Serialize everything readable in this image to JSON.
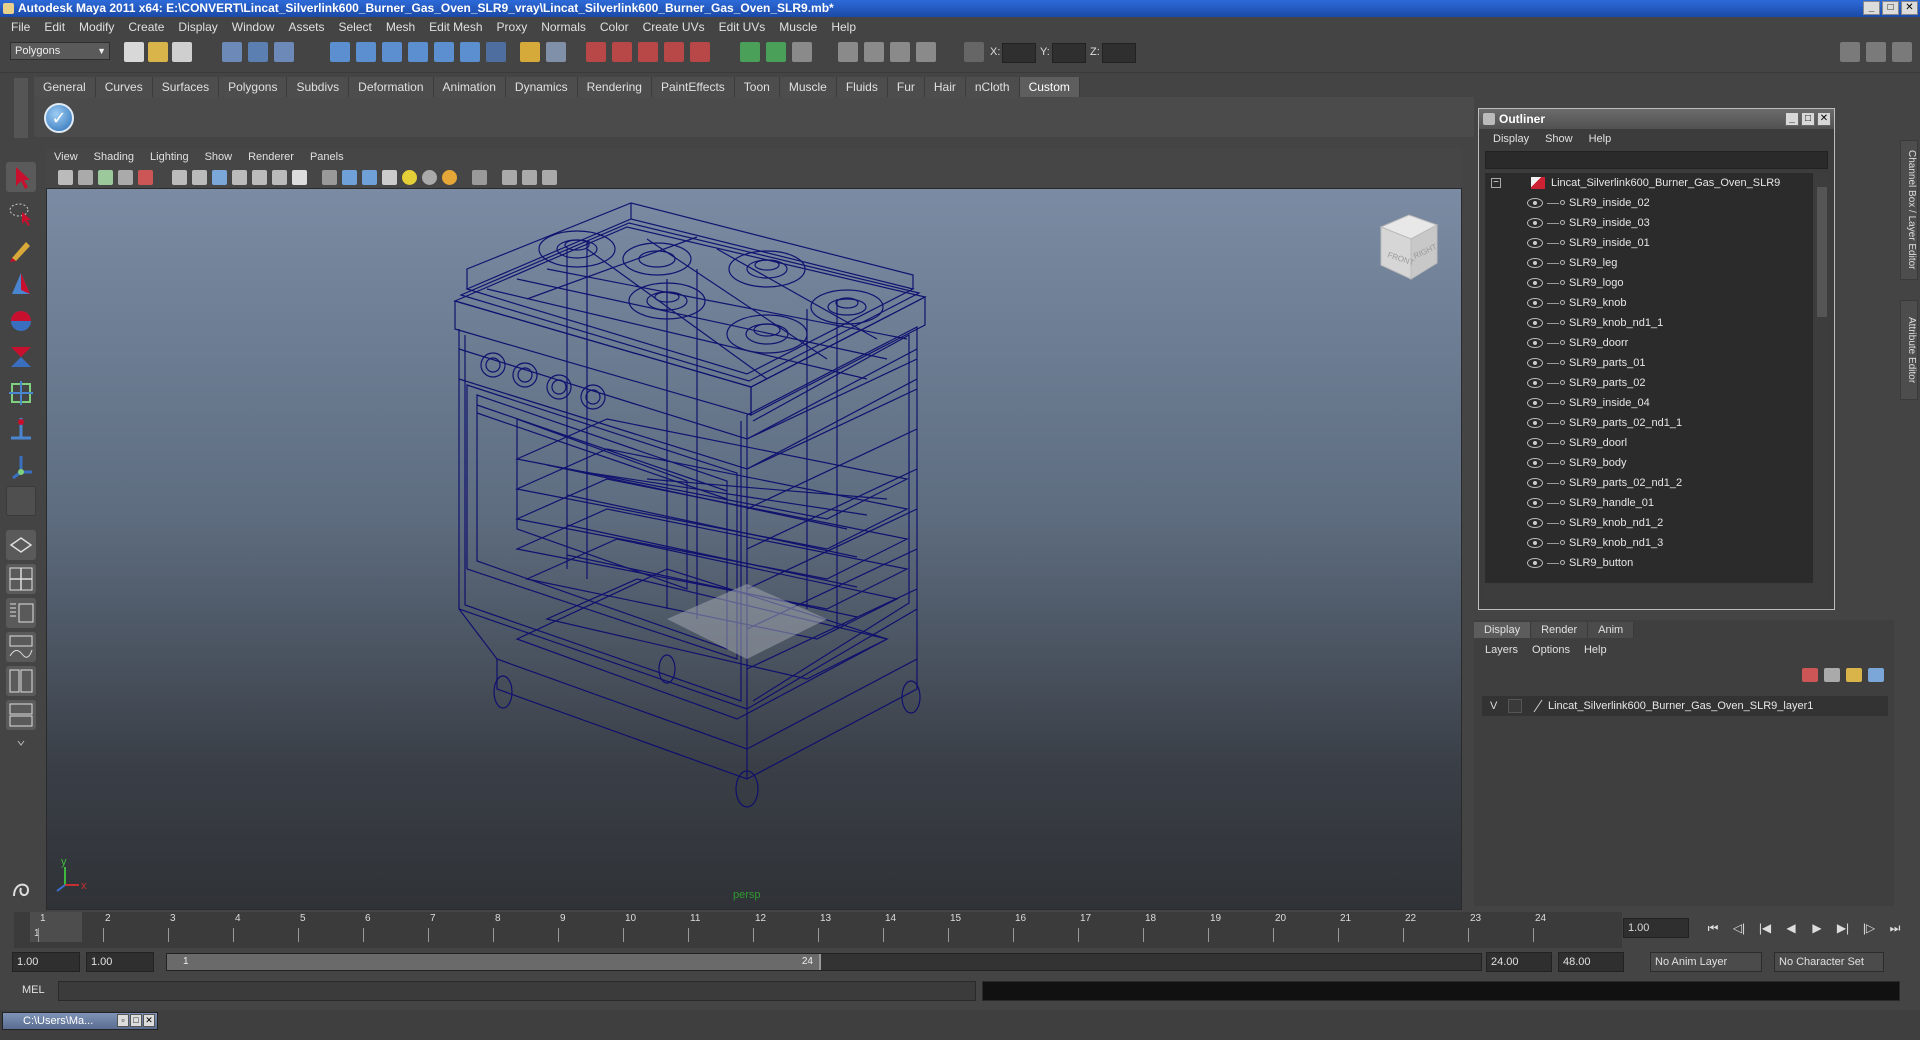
{
  "window": {
    "title": "Autodesk Maya 2011 x64: E:\\CONVERT\\Lincat_Silverlink600_Burner_Gas_Oven_SLR9_vray\\Lincat_Silverlink600_Burner_Gas_Oven_SLR9.mb*",
    "min": "_",
    "max": "□",
    "close": "✕"
  },
  "menubar": [
    "File",
    "Edit",
    "Modify",
    "Create",
    "Display",
    "Window",
    "Assets",
    "Select",
    "Mesh",
    "Edit Mesh",
    "Proxy",
    "Normals",
    "Color",
    "Create UVs",
    "Edit UVs",
    "Muscle",
    "Help"
  ],
  "statusline": {
    "mode": "Polygons",
    "x_label": "X:",
    "y_label": "Y:",
    "z_label": "Z:"
  },
  "shelf": {
    "tabs": [
      "General",
      "Curves",
      "Surfaces",
      "Polygons",
      "Subdivs",
      "Deformation",
      "Animation",
      "Dynamics",
      "Rendering",
      "PaintEffects",
      "Toon",
      "Muscle",
      "Fluids",
      "Fur",
      "Hair",
      "nCloth",
      "Custom"
    ],
    "active": "Custom",
    "check_glyph": "✓"
  },
  "viewport": {
    "menu": [
      "View",
      "Shading",
      "Lighting",
      "Show",
      "Renderer",
      "Panels"
    ],
    "camera": "persp",
    "cube_front": "FRONT",
    "cube_right": "RIGHT",
    "axis_x": "x",
    "axis_y": "y"
  },
  "outliner": {
    "title": "Outliner",
    "menu": [
      "Display",
      "Show",
      "Help"
    ],
    "root": "Lincat_Silverlink600_Burner_Gas_Oven_SLR9",
    "expand_glyph": "−",
    "items": [
      "SLR9_inside_02",
      "SLR9_inside_03",
      "SLR9_inside_01",
      "SLR9_leg",
      "SLR9_logo",
      "SLR9_knob",
      "SLR9_knob_nd1_1",
      "SLR9_doorr",
      "SLR9_parts_01",
      "SLR9_parts_02",
      "SLR9_inside_04",
      "SLR9_parts_02_nd1_1",
      "SLR9_doorl",
      "SLR9_body",
      "SLR9_parts_02_nd1_2",
      "SLR9_handle_01",
      "SLR9_knob_nd1_2",
      "SLR9_knob_nd1_3",
      "SLR9_button"
    ]
  },
  "side_tabs": {
    "channel_box": "Channel Box / Layer Editor",
    "attribute_editor": "Attribute Editor"
  },
  "layer_editor": {
    "tabs": [
      "Display",
      "Render",
      "Anim"
    ],
    "active": "Display",
    "menu": [
      "Layers",
      "Options",
      "Help"
    ],
    "layer_visible": "V",
    "layer_name": "Lincat_Silverlink600_Burner_Gas_Oven_SLR9_layer1"
  },
  "timeline": {
    "ticks": [
      "1",
      "2",
      "3",
      "4",
      "5",
      "6",
      "7",
      "8",
      "9",
      "10",
      "11",
      "12",
      "13",
      "14",
      "15",
      "16",
      "17",
      "18",
      "19",
      "20",
      "21",
      "22",
      "23",
      "24"
    ],
    "current_frame": "1",
    "current_time": "1.00"
  },
  "playback": {
    "buttons": [
      "⏮",
      "◁|",
      "|◀",
      "◀",
      "▶",
      "▶|",
      "|▷",
      "⏭"
    ]
  },
  "range": {
    "start": "1.00",
    "anim_start": "1.00",
    "range_start_label": "1",
    "range_end_label": "24",
    "end": "24.00",
    "anim_end": "48.00",
    "anim_layer": "No Anim Layer",
    "character_set": "No Character Set"
  },
  "command": {
    "label": "MEL"
  },
  "taskbar": {
    "minimized_title": "C:\\Users\\Ma..."
  },
  "colors": {
    "wireframe": "#0d0d6e",
    "title_blue": "#2d6ad9",
    "camera_label": "#2f9a2f"
  }
}
